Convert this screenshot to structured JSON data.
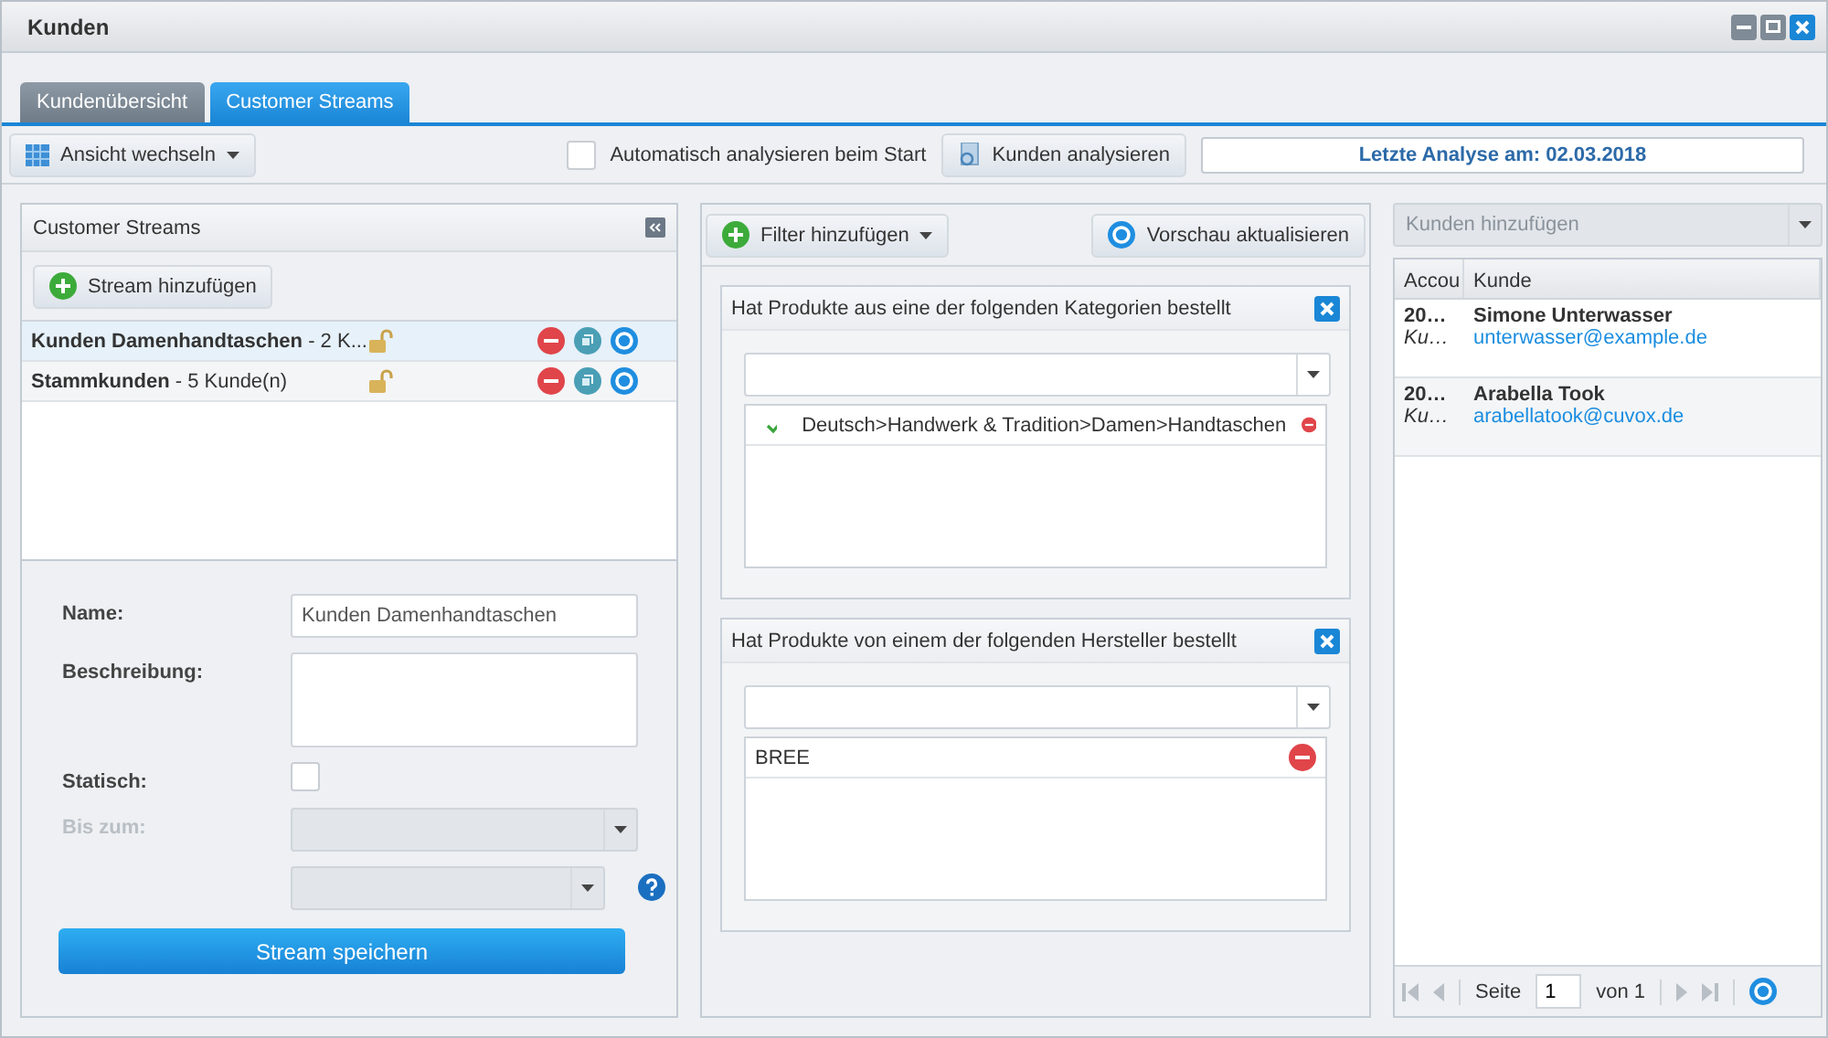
{
  "window": {
    "title": "Kunden"
  },
  "tabs": [
    {
      "label": "Kundenübersicht",
      "selected": false
    },
    {
      "label": "Customer Streams",
      "selected": true
    }
  ],
  "toolbar": {
    "view_button": "Ansicht wechseln",
    "auto_analyze": {
      "label": "Automatisch analysieren beim Start",
      "checked": false
    },
    "analyze_button": "Kunden analysieren",
    "last_analysis": "Letzte Analyse am: 02.03.2018"
  },
  "streams_panel": {
    "title": "Customer Streams",
    "add_button": "Stream hinzufügen",
    "items": [
      {
        "label": "**Kunden Damenhandtaschen** - 2 K...",
        "selected": true
      },
      {
        "label": "**Stammkunden** - 5 Kunde(n)",
        "selected": false
      }
    ]
  },
  "form": {
    "name_label": "Name:",
    "name_value": "Kunden Damenhandtaschen",
    "description_label": "Beschreibung:",
    "static_label": "Statisch:",
    "static_checked": false,
    "until_label": "Bis zum:",
    "until_disabled": true,
    "save_button": "Stream speichern"
  },
  "filter_toolbar": {
    "add_button": "Filter hinzufügen",
    "refresh_button": "Vorschau aktualisieren"
  },
  "filters": [
    {
      "title": "Hat Produkte aus eine der folgenden Kategorien bestellt",
      "entries": [
        {
          "text": "Deutsch>Handwerk & Tradition>Damen>Handtaschen",
          "checked": true
        }
      ]
    },
    {
      "title": "Hat Produkte von einem der folgenden Hersteller bestellt",
      "entries": [
        {
          "text": "BREE",
          "checked": false
        }
      ]
    }
  ],
  "customers": {
    "add_placeholder": "Kunden hinzufügen",
    "columns": [
      "Accou",
      "Kunde"
    ],
    "rows": [
      {
        "account": "20…",
        "type": "Ku…",
        "name": "Simone Unterwasser",
        "email": "unterwasser@example.de"
      },
      {
        "account": "20…",
        "type": "Ku…",
        "name": "Arabella Took",
        "email": "arabellatook@cuvox.de"
      }
    ],
    "pager": {
      "page_label": "Seite",
      "page": "1",
      "of": "von 1"
    }
  }
}
